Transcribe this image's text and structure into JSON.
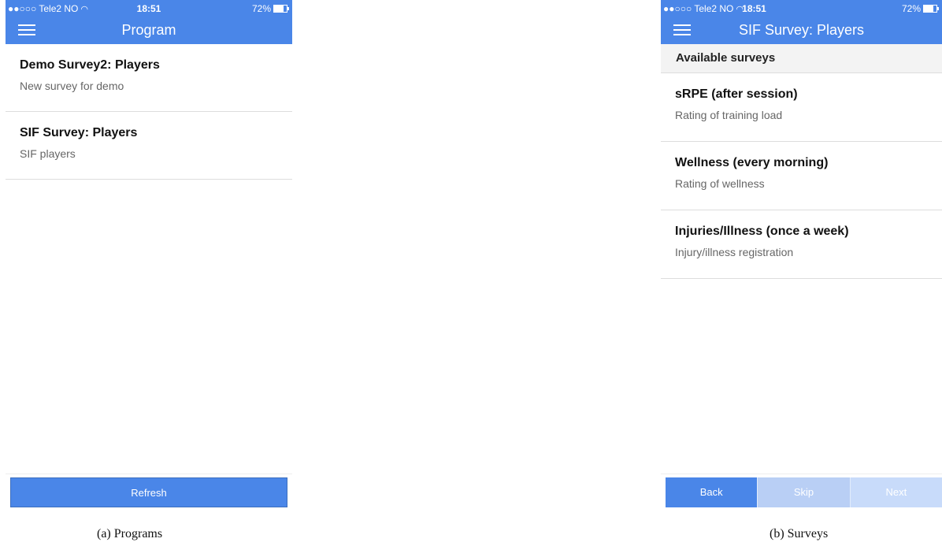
{
  "colors": {
    "accent": "#4a86e8",
    "disabled": "#c8dbfa"
  },
  "programs_screen": {
    "status": {
      "carrier": "●●○○○ Tele2 NO",
      "time": "18:51",
      "battery": "72%"
    },
    "nav_title": "Program",
    "items": [
      {
        "title": "Demo Survey2: Players",
        "subtitle": "New survey for demo"
      },
      {
        "title": "SIF Survey: Players",
        "subtitle": "SIF players"
      }
    ],
    "refresh_label": "Refresh",
    "caption": "(a)  Programs"
  },
  "surveys_screen": {
    "status": {
      "carrier": "●●○○○ Tele2 NO",
      "time": "18:51",
      "battery": "72%"
    },
    "nav_title": "SIF Survey: Players",
    "section_header": "Available surveys",
    "items": [
      {
        "title": "sRPE (after session)",
        "subtitle": "Rating of training load"
      },
      {
        "title": "Wellness (every morning)",
        "subtitle": "Rating of wellness"
      },
      {
        "title": "Injuries/Illness (once a week)",
        "subtitle": "Injury/illness registration"
      }
    ],
    "buttons": {
      "back": "Back",
      "skip": "Skip",
      "next": "Next"
    },
    "caption": "(b)  Surveys"
  }
}
